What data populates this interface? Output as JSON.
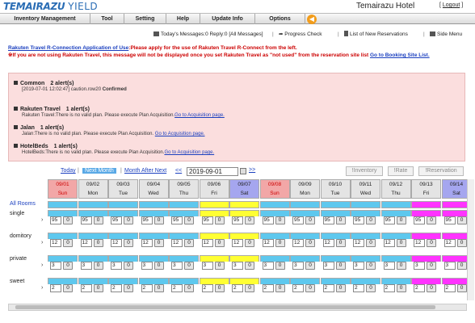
{
  "header": {
    "logo_main": "TEMAIRAZU",
    "logo_sub": "YIELD",
    "hotel_name": "Temairazu Hotel",
    "logout_label": "Logout"
  },
  "menu": {
    "items": [
      "Inventory Management",
      "Tool",
      "Setting",
      "Help",
      "Update Info",
      "Options"
    ]
  },
  "toolbar": {
    "messages": "Today's Messages:0 Reply:0 [All Messages]",
    "progress": "Progress Check",
    "reservations": "List of New Reservations",
    "side_menu": "Side Menu"
  },
  "notice": {
    "link1": "Rakuten Travel R-Connection Application of Use",
    "text1": ":Please apply for the use of Rakuten Travel R-Connect from the left.",
    "text2": "※If you are not using Rakuten Travel, this message will not be displayed once you set Rakuten Travel as \"not used\" from the reservation site list",
    "link2": "Go to Booking Site List."
  },
  "alerts": [
    {
      "title": "Common　2 alert(s)",
      "line": "[2019-07-01 12:02:47] caution.row20",
      "extra": "Confirmed",
      "link": ""
    },
    {
      "title": "Rakuten Travel　1 alert(s)",
      "line": "Rakuten Travel:There is no valid plan. Please execute Plan Acquisition.",
      "extra": "",
      "link": "Go to Acquisition page."
    },
    {
      "title": "Jalan　1 alert(s)",
      "line": "Jalan:There is no valid plan. Please execute Plan Acquisition.",
      "extra": "",
      "link": "Go to Acquisition page."
    },
    {
      "title": "HotelBeds　1 alert(s)",
      "line": "HotelBeds:There is no valid plan. Please execute Plan Acquisition.",
      "extra": "",
      "link": "Go to Acquisition page."
    }
  ],
  "datenav": {
    "today": "Today",
    "next_month": "Next Month",
    "month_after_next": "Month After Next",
    "prev": "<<",
    "date_value": "2019-09-01",
    "next": ">>",
    "btn_inventory": "!Inventory",
    "btn_rate": "!Rate",
    "btn_reservation": "!Reservation"
  },
  "grid": {
    "all_rooms": "All Rooms",
    "days": [
      {
        "date": "09/01",
        "dow": "Sun",
        "color": "#f2a7a7",
        "strip": "#5ec8ee"
      },
      {
        "date": "09/02",
        "dow": "Mon",
        "color": "#e4e4e4",
        "strip": "#5ec8ee"
      },
      {
        "date": "09/03",
        "dow": "Tue",
        "color": "#e4e4e4",
        "strip": "#5ec8ee"
      },
      {
        "date": "09/04",
        "dow": "Wed",
        "color": "#e4e4e4",
        "strip": "#5ec8ee"
      },
      {
        "date": "09/05",
        "dow": "Thu",
        "color": "#e4e4e4",
        "strip": "#5ec8ee"
      },
      {
        "date": "09/06",
        "dow": "Fri",
        "color": "#e4e4e4",
        "strip": "#ffff33"
      },
      {
        "date": "09/07",
        "dow": "Sat",
        "color": "#a5a6ef",
        "strip": "#ffff33"
      },
      {
        "date": "09/08",
        "dow": "Sun",
        "color": "#f2a7a7",
        "strip": "#5ec8ee"
      },
      {
        "date": "09/09",
        "dow": "Mon",
        "color": "#e4e4e4",
        "strip": "#5ec8ee"
      },
      {
        "date": "09/10",
        "dow": "Tue",
        "color": "#e4e4e4",
        "strip": "#5ec8ee"
      },
      {
        "date": "09/11",
        "dow": "Wed",
        "color": "#e4e4e4",
        "strip": "#5ec8ee"
      },
      {
        "date": "09/12",
        "dow": "Thu",
        "color": "#e4e4e4",
        "strip": "#5ec8ee"
      },
      {
        "date": "09/13",
        "dow": "Fri",
        "color": "#e4e4e4",
        "strip": "#ff33ff"
      },
      {
        "date": "09/14",
        "dow": "Sat",
        "color": "#a5a6ef",
        "strip": "#ff33ff"
      }
    ],
    "rooms": [
      {
        "name": "single",
        "stock": "95",
        "zero": "0"
      },
      {
        "name": "domitory",
        "stock": "12",
        "zero": "0"
      },
      {
        "name": "private",
        "stock": "3",
        "zero": "0"
      },
      {
        "name": "sweet",
        "stock": "2",
        "zero": "0"
      }
    ]
  }
}
